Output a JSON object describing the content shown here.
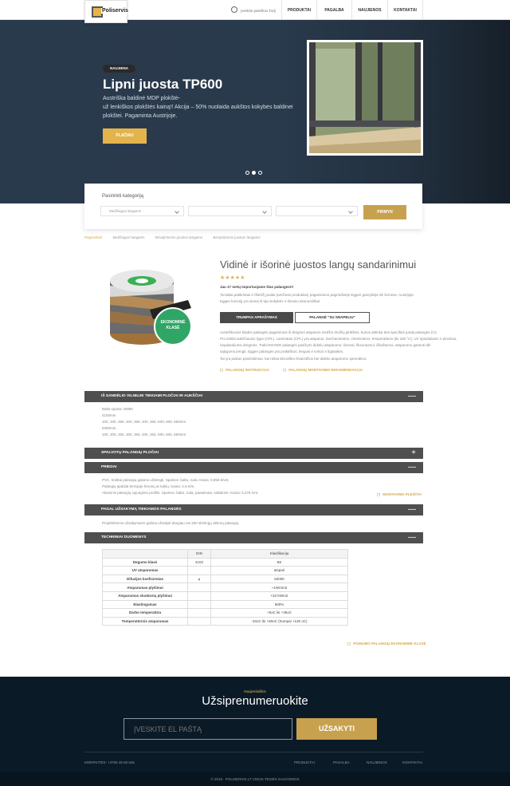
{
  "header": {
    "logo": "Poliservis",
    "search_placeholder": "Įveskite paieškos žodį",
    "nav": [
      "PRODUKTAI",
      "PAGALBA",
      "NAUJIENOS",
      "KONTAKTAI"
    ]
  },
  "hero": {
    "badge": "NAUJIENA",
    "title": "Lipni juosta TP600",
    "desc_line1": "Austriška baldinė MDP plokštė-",
    "desc_line2": "už lenkiškos plokštės kainą!! Akcija – 50% nuolaida aukštos kokybės baldinei plokštei. Pagaminta Austrijoje.",
    "button": "PLAČIAU",
    "active_slide": 2
  },
  "filter": {
    "label": "Pasirinkti kategoriją",
    "select1": "Medžiagos langams",
    "select2": "",
    "select3": "",
    "button": "PIRMYN"
  },
  "breadcrumb": [
    "Pagrindinis",
    "Medžiagos langams",
    "Bevipintomis juostos langams",
    "Bevipintomis juostos langams"
  ],
  "product": {
    "title": "Vidinė ir išorinė juostos langų sandarinimui",
    "stars": "★★★★★",
    "question": "Jau 17 metų importuojame šias palanges!!!",
    "intro_line1": "Tai labai patikrintas ir išbrėžį juodai (amžinas produktas) pagaminimo pagrindinėje Eggen gamykloje 8k žemėse, Austrijoje.",
    "intro_line2": "Eggen koncėjį yra vienai iš tipo kokybės ir dizaino ekonomiškai.",
    "badge_line1": "EKONOMINĖ",
    "badge_line2": "KLASĖ",
    "tab_active": "TRUMPAS APRAŠYMAS",
    "tab_other": "PALANGĖ \"SU SNAPELIU\"",
    "desc_lines": [
      "Austriškosios kladės palangės pagamintos iš drėgmei atsparios medžio drožlių plokštės, kurios atitinka test specifinė juoda palangės (Cs",
      "Pro tinklai aukščiausio lygio (CPL). Laminatas (CPL) yra atsparus: mechaniniams, cheminiams, temperatūros (iki 180 °C), UV spinduliams ir plovimui,",
      "nepalankioms drėgmės. Todėl EGGER palangės pasižymi dideliu atsparumu: šviesai, fiksuotumui, iškoštumui, atsparumo gaminti dėl",
      "sąlygoms įrengti. Eggen palanges yra praktiškos, lengvai ir tvirtos ir ilgalaikės.",
      "Tai yra puikus pasirinkimas, kai reikia tikroviško išvaizdžios bei didelio atsparumo sprendimo."
    ],
    "link_install": "PALANGIŲ INSTRUKCIJA",
    "link_recommend": "PALANGIŲ MONTAVIMO REKOMENDACIJA"
  },
  "accordions": [
    {
      "title": "IŠ SANDĖLIO VILNIUJE TIEKIAMI PLOČIAI IR AUKŠČIAI",
      "sign": "—"
    },
    {
      "title": "SPALVOTŲ PALANGIŲ PLOČIAI",
      "sign": "+"
    },
    {
      "title": "PRIEDAI",
      "sign": "—"
    },
    {
      "title": "PAGAL UŽSAKYMĄ TIEKIAMOS PALANGĖS",
      "sign": "—"
    },
    {
      "title": "TECHNINIAI DUOMENYS",
      "sign": "—"
    }
  ],
  "acc1_lines": [
    "Balta spalva: W980",
    "4100mm",
    "100, 200, 250, 300, 350, 400, 450, 500, 600, 650mm",
    "5300mm",
    "100, 200, 250, 300, 350, 400, 450, 500, 600, 650mm"
  ],
  "acc3_lines": [
    "PVC, kraštai palangių galams uždengti. Spalvos: balta, ruda. Kaina: 0,956 €/vnt.",
    "Palangių apdaila termijoje hėronų ar kaklų. Kaina: 2,5 €/m.",
    "Aliuminis palangių sujungimo profilis. Spalvos: balta, ruda, paauksuta, sidabrinė. Kaina: 5,27€ /vnt."
  ],
  "acc3_link": "MONTAVIMO PLEIŠTAI",
  "acc4_text": "Projektinėmis užsakymams galima užsakyti daugiau nei 250 skirtingų dekorų palangių.",
  "table": {
    "headers": [
      "",
      "DIN",
      "Klasifikacija"
    ],
    "rows": [
      [
        "Degumo klasė",
        "4102",
        "B2"
      ],
      [
        "UV atsparumas",
        "",
        "atsparі"
      ],
      [
        "Difuzijos koeficientas",
        "μ",
        "52000"
      ],
      [
        "Atsparumas plyšimui",
        "",
        "~1N/mm2"
      ],
      [
        "Atsparumas sluoksnių plyšimui",
        "",
        "<10 kN/m2"
      ],
      [
        "Elastingumas",
        "",
        "600%"
      ],
      [
        "Darbo temperatūra",
        "",
        "+5oC iki +35oC"
      ],
      [
        "Temperatūrinis atsparumas",
        "",
        "-40oC iki +80oC (trumpai +130 oC)"
      ]
    ]
  },
  "table_link": "PODIUMO PALANGIŲ EKONOMINĖ KLASĖ",
  "footer": {
    "small": "Naujienlaiškis",
    "title": "Užsiprenumeruokite",
    "email_placeholder": "ĮVESKITE EL PAŠTĄ",
    "subscribe": "UŽSAKYTI",
    "phone": "KREIPKITĖS: +3706 46 60 645",
    "links": [
      "PRODUKTAI",
      "PAGALBA",
      "NAUJIENOS",
      "KONTAKTAI"
    ],
    "copyright": "© 2019 . POLISERVIS.LT VISOS TEISĖS SAUGOMOS"
  },
  "colors": {
    "accent": "#e3b44c",
    "dark": "#4f4f4f",
    "footer": "#0b1a27",
    "hero": "#293a4c",
    "badge_green": "#2fa665"
  }
}
